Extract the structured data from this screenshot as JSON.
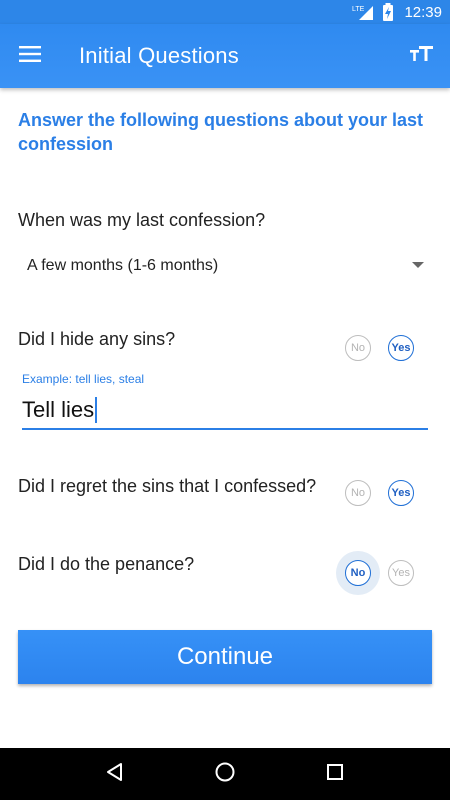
{
  "status_bar": {
    "network": "LTE",
    "time": "12:39"
  },
  "app_bar": {
    "title": "Initial Questions",
    "menu_icon": "hamburger-menu-icon",
    "text_size_icon": "text-size-icon"
  },
  "intro": "Answer the following questions about your last confession",
  "questions": {
    "last_confession": {
      "label": "When was my last confession?",
      "selected": "A few months (1-6 months)"
    },
    "hide_sins": {
      "label": "Did I hide any sins?",
      "no": "No",
      "yes": "Yes",
      "answer": "Yes",
      "hint": "Example: tell lies, steal",
      "input_value": "Tell lies"
    },
    "regret": {
      "label": "Did I regret the sins that I confessed?",
      "no": "No",
      "yes": "Yes",
      "answer": "Yes"
    },
    "penance": {
      "label": "Did I do the penance?",
      "no": "No",
      "yes": "Yes",
      "answer": "No"
    }
  },
  "continue_label": "Continue",
  "colors": {
    "primary": "#2d86e8",
    "accent_text": "#2b7fe6",
    "selected_choice": "#1f6fd6"
  }
}
